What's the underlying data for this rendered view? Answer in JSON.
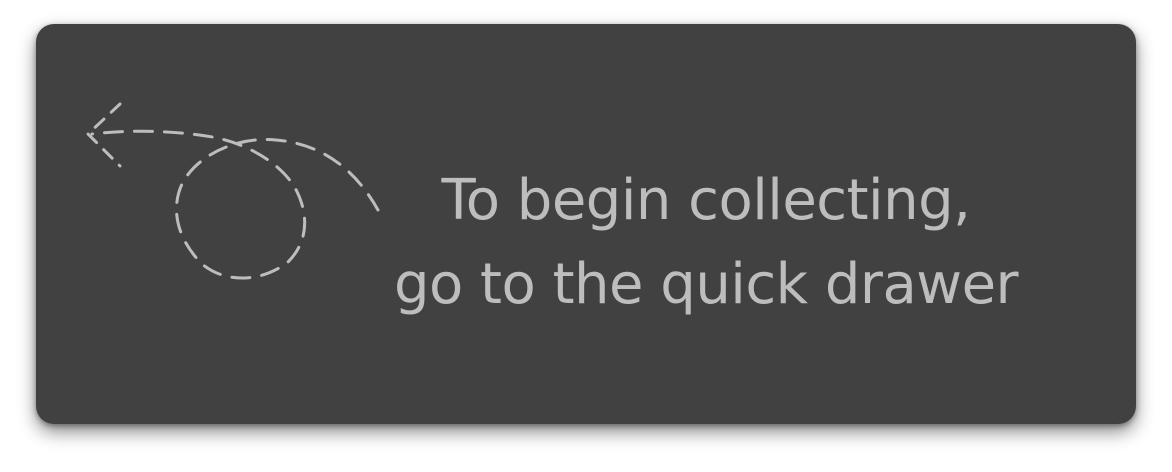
{
  "hint": {
    "line1": "To begin collecting,",
    "line2": "go to the quick drawer",
    "icon": "dashed-curved-arrow-left-icon",
    "text_color": "#bdbdbd",
    "panel_color": "#414141"
  }
}
